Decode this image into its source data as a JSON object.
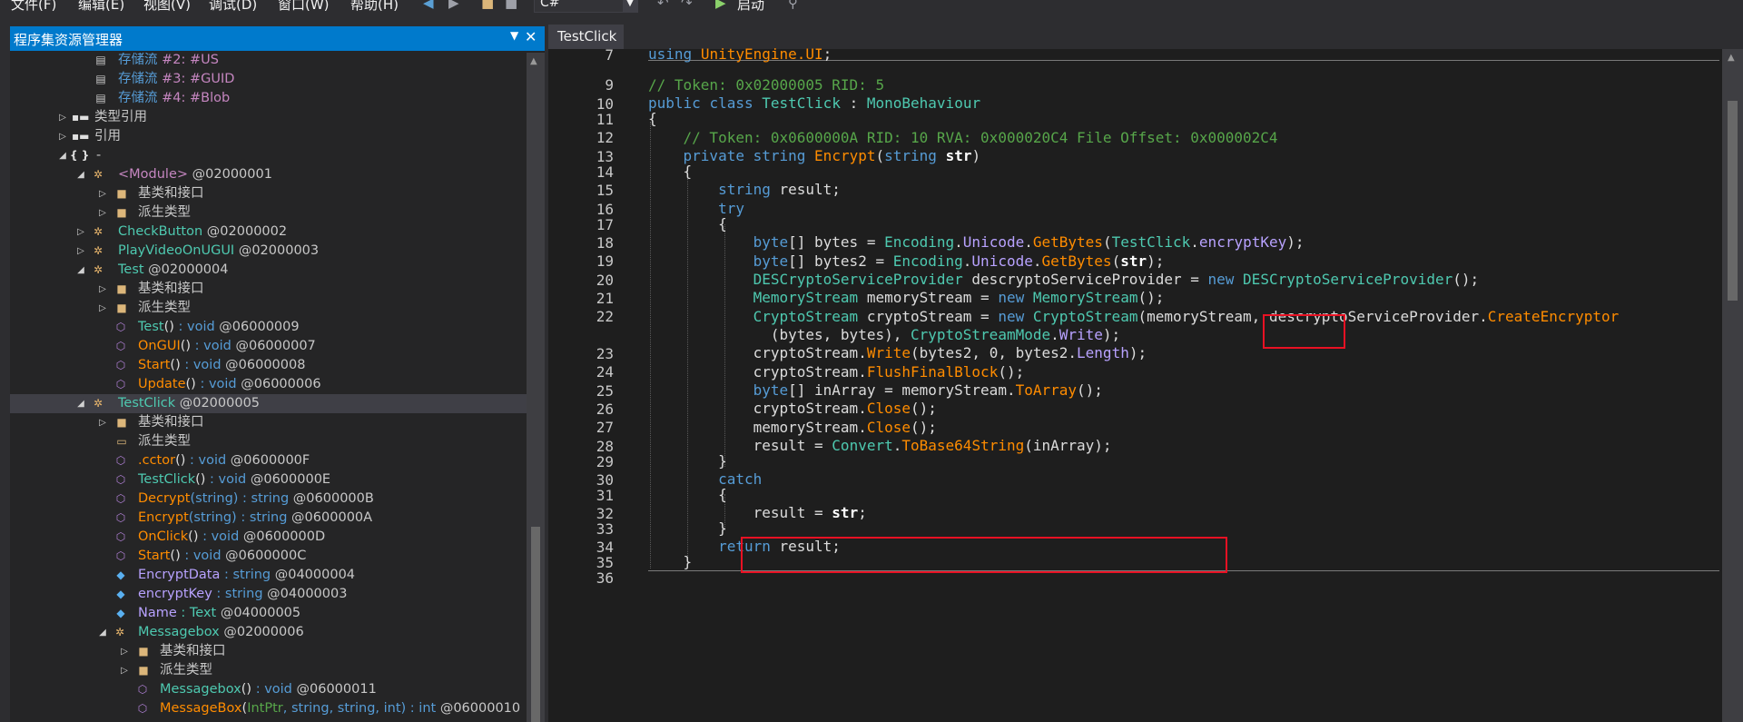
{
  "menubar": {
    "items": [
      "文件(F)",
      "编辑(E)",
      "视图(V)",
      "调试(D)",
      "窗口(W)",
      "帮助(H)"
    ],
    "language": "C#",
    "start_label": "启动"
  },
  "explorer": {
    "title": "程序集资源管理器",
    "rows": [
      {
        "kw": "存储流",
        "rest": " #2: #US"
      },
      {
        "kw": "存储流",
        "rest": " #3: #GUID"
      },
      {
        "kw": "存储流",
        "rest": " #4: #Blob"
      },
      {
        "label": "类型引用"
      },
      {
        "label": "引用"
      },
      {
        "label": "-"
      },
      {
        "name": "<Module>",
        "meta": " @02000001"
      },
      {
        "label": "基类和接口"
      },
      {
        "label": "派生类型"
      },
      {
        "name": "CheckButton",
        "meta": " @02000002"
      },
      {
        "name": "PlayVideoOnUGUI",
        "meta": " @02000003"
      },
      {
        "name": "Test",
        "meta": " @02000004"
      },
      {
        "label": "基类和接口"
      },
      {
        "label": "派生类型"
      },
      {
        "name": "Test",
        "sig": "()",
        "ret": " : void",
        "meta": " @06000009"
      },
      {
        "name": "OnGUI",
        "sig": "()",
        "ret": " : void",
        "meta": " @06000007"
      },
      {
        "name": "Start",
        "sig": "()",
        "ret": " : void",
        "meta": " @06000008"
      },
      {
        "name": "Update",
        "sig": "()",
        "ret": " : void",
        "meta": " @06000006"
      },
      {
        "name": "TestClick",
        "meta": " @02000005"
      },
      {
        "label": "基类和接口"
      },
      {
        "label": "派生类型"
      },
      {
        "name": ".cctor",
        "sig": "()",
        "ret": " : void",
        "meta": " @0600000F"
      },
      {
        "name": "TestClick",
        "sig": "()",
        "ret": " : void",
        "meta": " @0600000E"
      },
      {
        "name": "Decrypt",
        "sig": "(string)",
        "ret": " : string",
        "meta": " @0600000B"
      },
      {
        "name": "Encrypt",
        "sig": "(string)",
        "ret": " : string",
        "meta": " @0600000A"
      },
      {
        "name": "OnClick",
        "sig": "()",
        "ret": " : void",
        "meta": " @0600000D"
      },
      {
        "name": "Start",
        "sig": "()",
        "ret": " : void",
        "meta": " @0600000C"
      },
      {
        "name": "EncryptData",
        "ret": " : string",
        "meta": " @04000004"
      },
      {
        "name": "encryptKey",
        "ret": " : string",
        "meta": " @04000003"
      },
      {
        "name": "Name",
        "ret": " : Text",
        "meta": " @04000005"
      },
      {
        "name": "Messagebox",
        "meta": " @02000006"
      },
      {
        "label": "基类和接口"
      },
      {
        "label": "派生类型"
      },
      {
        "name": "Messagebox",
        "sig": "()",
        "ret": " : void",
        "meta": " @06000011"
      },
      {
        "name": "MessageBox",
        "sig_a": "(",
        "sig_b": "IntPtr",
        "sig_c": ", string, string, int)",
        "ret": " : int",
        "meta": " @06000010"
      }
    ]
  },
  "tab": {
    "label": "TestClick"
  },
  "code": {
    "line_numbers": [
      "7",
      "9",
      "10",
      "11",
      "12",
      "13",
      "14",
      "15",
      "16",
      "17",
      "18",
      "19",
      "20",
      "21",
      "22",
      "23",
      "24",
      "25",
      "26",
      "27",
      "28",
      "29",
      "30",
      "31",
      "32",
      "33",
      "34",
      "35",
      "36"
    ],
    "using_kw": "using",
    "using_ns": "UnityEngine.UI",
    "semicolon": ";",
    "token_class": "// Token: 0x02000005 RID: 5",
    "public_kw": "public",
    "class_kw": "class",
    "class_name": "TestClick",
    "colon": " : ",
    "base_name": "MonoBehaviour",
    "open_brace": "{",
    "close_brace": "}",
    "token_method": "// Token: 0x0600000A RID: 10 RVA: 0x000020C4 File Offset: 0x000002C4",
    "private_kw": "private",
    "string_kw": "string",
    "method_name": "Encrypt",
    "param_open": "(",
    "param_name": "str",
    "param_close": ")",
    "result_decl": " result;",
    "try_kw": "try",
    "byte_kw": "byte",
    "l18_a": "[] bytes = ",
    "encoding": "Encoding",
    "dot": ".",
    "unicode": "Unicode",
    "getbytes": "GetBytes",
    "testclick": "TestClick",
    "encryptkey": "encryptKey",
    "l18_end": ");",
    "l19_a": "[] bytes2 = ",
    "l19_end": ");",
    "descsp": "DESCryptoServiceProvider",
    "l20_a": " descryptoServiceProvider = ",
    "new_kw": "new",
    "l20_end": "();",
    "memstream": "MemoryStream",
    "l21_a": " memoryStream = ",
    "l21_end": "();",
    "cryptostream": "CryptoStream",
    "l22_a": " cryptoStream = ",
    "l22_b": "(memoryStream, descryptoServiceProvider.",
    "createenc": "CreateEncryptor",
    "l22c_a": "  (bytes, bytes), ",
    "cryptomode": "CryptoStreamMode",
    "write_field": "Write",
    "l22c_end": ");",
    "l23_a": "cryptoStream.",
    "write": "Write",
    "l23_b": "(bytes2, 0, bytes2.",
    "length": "Length",
    "l23_end": ");",
    "l24_a": "cryptoStream.",
    "flush": "FlushFinalBlock",
    "l24_end": "();",
    "l25_a": "[] inArray = memoryStream.",
    "toarray": "ToArray",
    "l25_end": "();",
    "l26_a": "cryptoStream.",
    "close": "Close",
    "l26_end": "();",
    "l27_a": "memoryStream.",
    "l27_end": "();",
    "l28_a": "result = ",
    "convert": "Convert",
    "tobase64": "ToBase64String",
    "l28_end": "(inArray);",
    "catch_kw": "catch",
    "l32_a": "result = ",
    "l32_str": "str",
    "l32_end": ";",
    "return_kw": "return",
    "l34_end": " result;"
  }
}
